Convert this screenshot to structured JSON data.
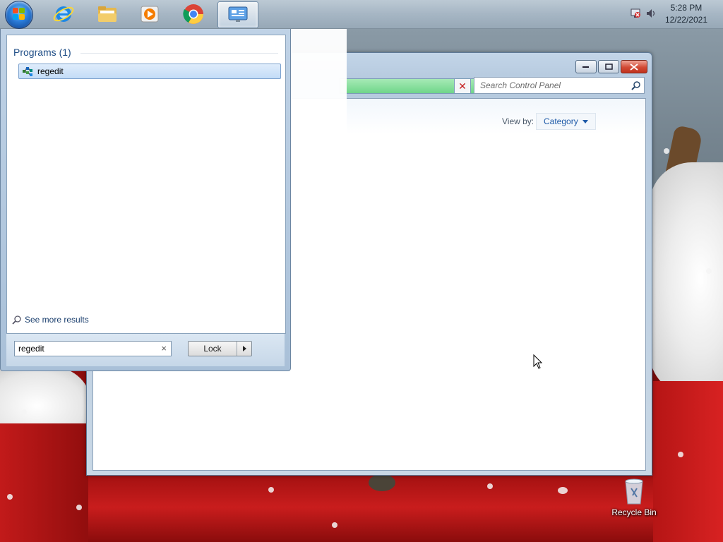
{
  "taskbar": {
    "apps": [
      {
        "name": "Internet Explorer",
        "icon": "internet-explorer-icon"
      },
      {
        "name": "Windows Explorer",
        "icon": "folder-icon"
      },
      {
        "name": "Windows Media Player",
        "icon": "media-player-icon"
      },
      {
        "name": "Google Chrome",
        "icon": "chrome-icon"
      },
      {
        "name": "Control Panel",
        "icon": "control-panel-icon",
        "active": true
      }
    ],
    "clock": {
      "time": "5:28 PM",
      "date": "12/22/2021"
    }
  },
  "control_panel": {
    "search_placeholder": "Search Control Panel",
    "view_by_label": "View by:",
    "view_by_value": "Category"
  },
  "start_menu": {
    "programs_header": "Programs (1)",
    "results": [
      {
        "label": "regedit",
        "icon": "registry-editor-icon"
      }
    ],
    "see_more": "See more results",
    "search_value": "regedit",
    "power_button_label": "Lock"
  },
  "desktop": {
    "icons": [
      {
        "label": "Recycle Bin",
        "icon": "recycle-bin-icon"
      }
    ]
  },
  "colors": {
    "taskbar": "#a6b6c4",
    "start_menu": "#bfd2e6",
    "selection": "#c3dcf7",
    "link": "#1e5aa8"
  }
}
